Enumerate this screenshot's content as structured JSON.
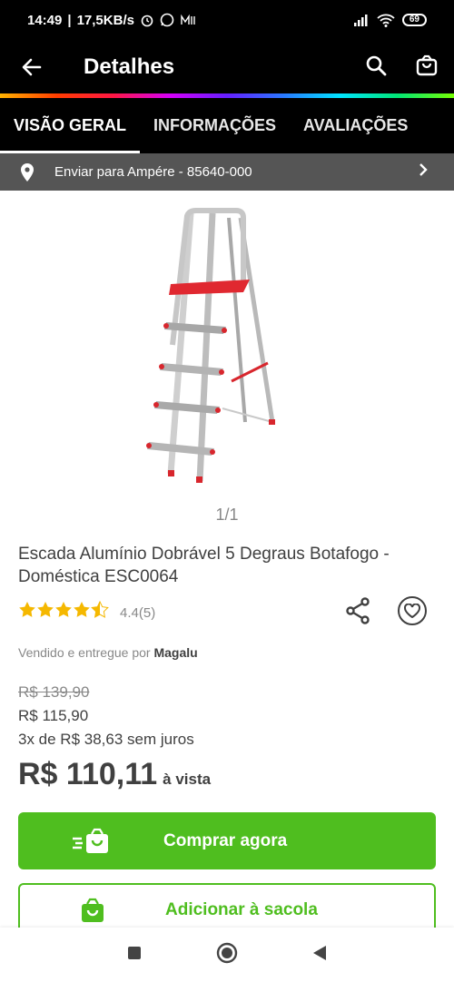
{
  "status": {
    "time": "14:49",
    "speed": "17,5KB/s",
    "battery": "69"
  },
  "appbar": {
    "title": "Detalhes"
  },
  "tabs": [
    {
      "label": "VISÃO GERAL",
      "active": true
    },
    {
      "label": "INFORMAÇÕES",
      "active": false
    },
    {
      "label": "AVALIAÇÕES",
      "active": false
    }
  ],
  "shipping": {
    "label": "Enviar para Ampére - 85640-000"
  },
  "gallery": {
    "counter": "1/1"
  },
  "product": {
    "title": "Escada Alumínio Dobrável 5 Degraus Botafogo - Doméstica ESC0064",
    "rating_text": "4.4(5)",
    "rating_value": 4.4,
    "seller_prefix": "Vendido e entregue por",
    "seller_name": "Magalu",
    "old_price": "R$ 139,90",
    "price": "R$ 115,90",
    "installments": "3x de R$ 38,63 sem juros",
    "cash_price": "R$ 110,11",
    "cash_suffix": "à vista"
  },
  "actions": {
    "buy_label": "Comprar agora",
    "add_label": "Adicionar à sacola"
  },
  "colors": {
    "accent": "#4fbe1f",
    "header": "#000000",
    "shipbar": "#555555",
    "star": "#f5b800"
  },
  "icons": [
    "back-arrow-icon",
    "search-icon",
    "bag-icon",
    "location-pin-icon",
    "chevron-right-icon",
    "share-icon",
    "heart-icon",
    "fast-bag-icon",
    "bag-icon",
    "nav-square-icon",
    "nav-circle-icon",
    "nav-back-triangle-icon"
  ]
}
